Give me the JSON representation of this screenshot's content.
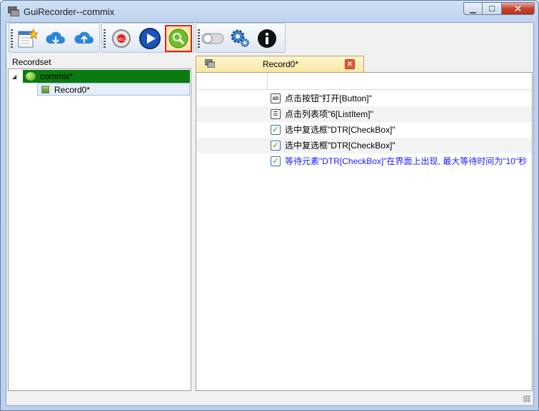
{
  "window": {
    "title": "GuiRecorder--commix"
  },
  "toolbar": {
    "buttons": [
      {
        "name": "new-record-icon"
      },
      {
        "name": "cloud-download-icon"
      },
      {
        "name": "cloud-upload-icon"
      },
      {
        "name": "record-icon"
      },
      {
        "name": "play-icon"
      },
      {
        "name": "search-icon",
        "selected": true
      },
      {
        "name": "toggle-icon"
      },
      {
        "name": "settings-gear-icon"
      },
      {
        "name": "info-icon"
      }
    ]
  },
  "recordset": {
    "header": "Recordset",
    "root": {
      "label": "commix*"
    },
    "children": [
      {
        "label": "Record0*"
      }
    ]
  },
  "editor": {
    "tab": {
      "label": "Record0*"
    },
    "steps": [
      {
        "icon": "ab",
        "text": "点击按钮\"打开[Button]\"",
        "highlight": false
      },
      {
        "icon": "list",
        "text": "点击列表项\"6[ListItem]\"",
        "highlight": false
      },
      {
        "icon": "check",
        "text": "选中复选框\"DTR[CheckBox]\"",
        "highlight": false
      },
      {
        "icon": "check",
        "text": "选中复选框\"DTR[CheckBox]\"",
        "highlight": false
      },
      {
        "icon": "check",
        "text": "等待元素\"DTR[CheckBox]\"在界面上出现, 最大等待时间为\"10\"秒",
        "highlight": true
      }
    ]
  },
  "colors": {
    "selection_green": "#0a7a10",
    "highlight_text": "#1a1aff",
    "selected_tool_border": "#e02020"
  }
}
